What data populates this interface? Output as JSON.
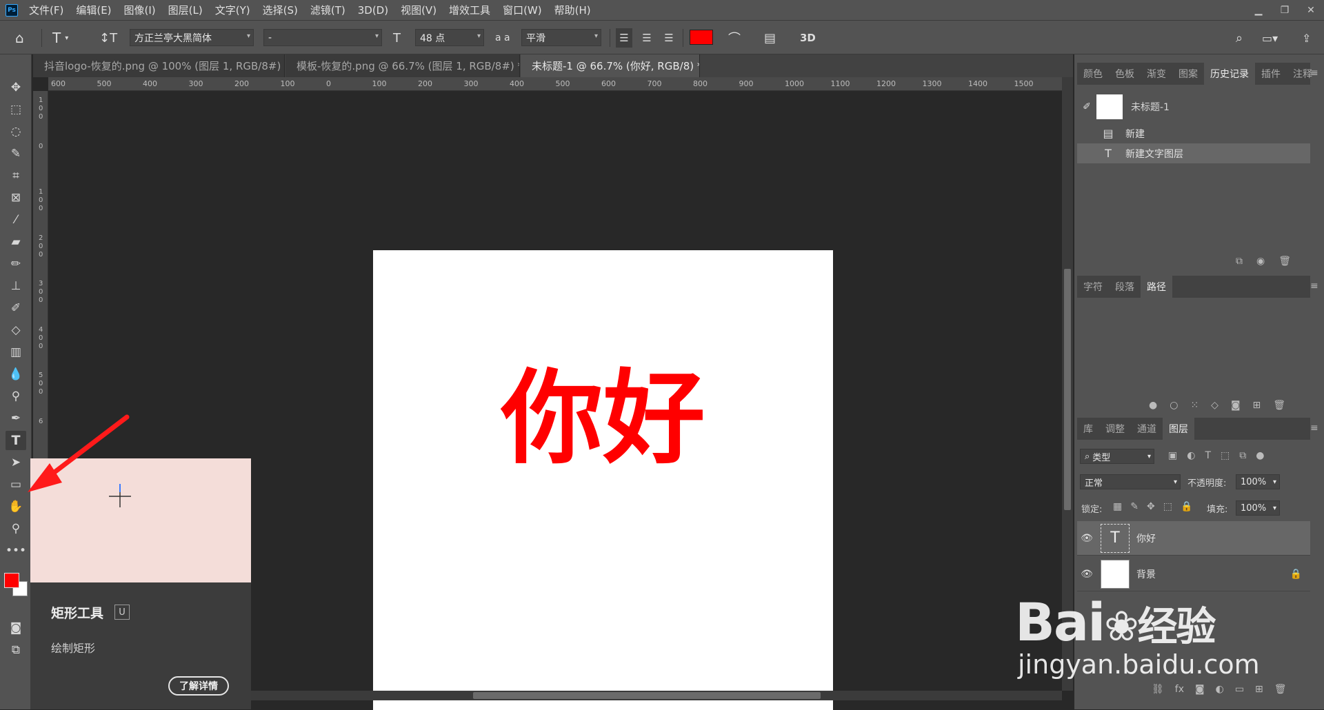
{
  "menubar": {
    "logo": "Ps",
    "items": [
      "文件(F)",
      "编辑(E)",
      "图像(I)",
      "图层(L)",
      "文字(Y)",
      "选择(S)",
      "滤镜(T)",
      "3D(D)",
      "视图(V)",
      "增效工具",
      "窗口(W)",
      "帮助(H)"
    ],
    "window_controls": [
      "minimize-icon",
      "restore-icon",
      "close-icon"
    ]
  },
  "options": {
    "font_family": "方正兰亭大黑简体",
    "font_style": "-",
    "font_size": "48 点",
    "aa_label": "a a",
    "antialias": "平滑",
    "text_color": "#ff0000",
    "three_d": "3D"
  },
  "tabs": [
    {
      "label": "抖音logo-恢复的.png @ 100% (图层 1, RGB/8#) *",
      "active": false
    },
    {
      "label": "模板-恢复的.png @ 66.7% (图层 1, RGB/8#) *",
      "active": false
    },
    {
      "label": "未标题-1 @ 66.7% (你好, RGB/8) *",
      "active": true
    }
  ],
  "rulers": {
    "h_ticks": [
      "600",
      "500",
      "400",
      "300",
      "200",
      "100",
      "0",
      "100",
      "200",
      "300",
      "400",
      "500",
      "600",
      "700",
      "800",
      "900",
      "1000",
      "1100",
      "1200",
      "1300",
      "1400",
      "1500"
    ],
    "v_ticks": [
      "1\n0\n0",
      "0",
      "1\n0\n0",
      "2\n0\n0",
      "3\n0\n0",
      "4\n0\n0",
      "5\n0\n0",
      "6"
    ]
  },
  "document": {
    "text": "你好",
    "text_color": "#ff0000"
  },
  "tooltip": {
    "title": "矩形工具",
    "shortcut": "U",
    "description": "绘制矩形",
    "more_button": "了解详情"
  },
  "colors": {
    "foreground": "#ff0000",
    "background": "#ffffff",
    "accent_arrow": "#ff1a1a"
  },
  "history_panel": {
    "tabs": [
      "颜色",
      "色板",
      "渐变",
      "图案",
      "历史记录",
      "插件",
      "注释"
    ],
    "active_tab": "历史记录",
    "snapshot": "未标题-1",
    "items": [
      {
        "icon": "document-icon",
        "label": "新建",
        "selected": false
      },
      {
        "icon": "text-icon",
        "label": "新建文字图层",
        "selected": true
      }
    ]
  },
  "paths_panel": {
    "tabs": [
      "字符",
      "段落",
      "路径"
    ],
    "active_tab": "路径"
  },
  "layers_panel": {
    "tabs": [
      "库",
      "调整",
      "通道",
      "图层"
    ],
    "active_tab": "图层",
    "filter_kind": "类型",
    "blend_mode": "正常",
    "opacity_label": "不透明度:",
    "opacity": "100%",
    "lock_label": "锁定:",
    "fill_label": "填充:",
    "fill": "100%",
    "layers": [
      {
        "name": "你好",
        "type": "text",
        "selected": true
      },
      {
        "name": "背景",
        "type": "image",
        "selected": false,
        "locked": true
      }
    ]
  },
  "watermark": {
    "brand": "Bai",
    "brand2": "经验",
    "url": "jingyan.baidu.com"
  }
}
